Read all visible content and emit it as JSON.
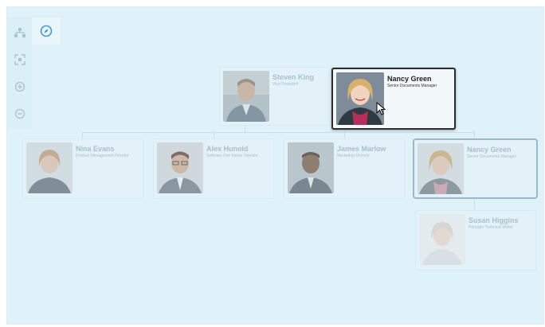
{
  "toolbar": {
    "tools": [
      {
        "name": "hierarchy-icon"
      },
      {
        "name": "fit-icon"
      },
      {
        "name": "zoom-in-icon"
      },
      {
        "name": "zoom-out-icon"
      }
    ],
    "active_tool": {
      "name": "navigate-compass-icon"
    }
  },
  "cards": {
    "steven_king": {
      "name": "Steven King",
      "title": "Vice President"
    },
    "nancy_drag": {
      "name": "Nancy Green",
      "title": "Senior Documents Manager"
    },
    "nina_evans": {
      "name": "Nina Evans",
      "title": "Product Management Director"
    },
    "alex_hunold": {
      "name": "Alex Hunold",
      "title": "Software Dev Senior Director"
    },
    "james_marlow": {
      "name": "James Marlow",
      "title": "Marketing Director"
    },
    "nancy_green": {
      "name": "Nancy Green",
      "title": "Senior Documents Manager"
    },
    "susan_higgins": {
      "name": "Susan Higgins",
      "title": "Principle Technical Writer"
    }
  },
  "colors": {
    "canvas": "#dff2f9",
    "card_faded": "#e2f2f8",
    "faded_text": "#a9bfc8",
    "focus_border": "#2d2d2d",
    "selected_border": "#9bb8c3"
  }
}
